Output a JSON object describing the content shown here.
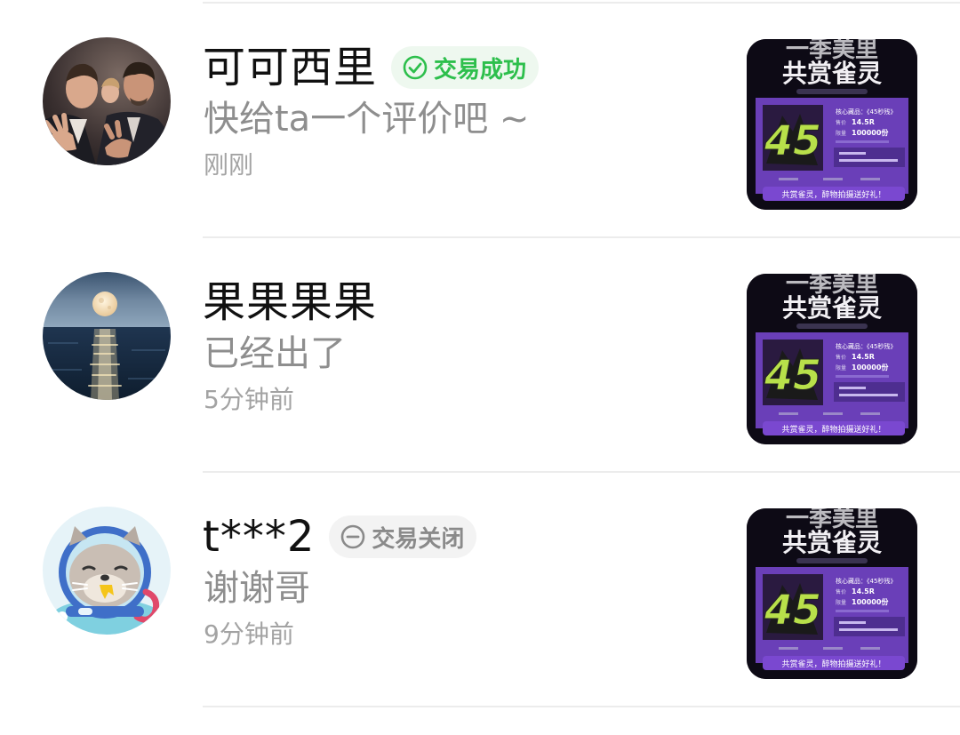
{
  "conversations": [
    {
      "username": "可可西里",
      "status_badge": "交易成功",
      "status_type": "success",
      "last_message": "快给ta一个评价吧 ~",
      "time": "刚刚",
      "avatar_icon": "people-photo-avatar"
    },
    {
      "username": "果果果果",
      "status_badge": "",
      "status_type": "none",
      "last_message": "已经出了",
      "time": "5分钟前",
      "avatar_icon": "moon-over-sea-avatar"
    },
    {
      "username": "t***2",
      "status_badge": "交易关闭",
      "status_type": "closed",
      "last_message": "谢谢哥",
      "time": "9分钟前",
      "avatar_icon": "cartoon-seal-astronaut-avatar"
    }
  ],
  "product_thumbnail": {
    "title": "共赏雀灵",
    "info_label": "核心藏品：《45秒残》",
    "price": "14.5R",
    "supply": "100000份",
    "big_number": "45",
    "footer": "共赏雀灵，醉物拍摄送好礼！"
  },
  "colors": {
    "success": "#2dbf4c",
    "success_bg": "#eef8ef",
    "closed": "#8a8a8a",
    "closed_bg": "#f3f3f3",
    "thumb_purple": "#6a3fb8",
    "thumb_accent": "#b8e04a"
  }
}
